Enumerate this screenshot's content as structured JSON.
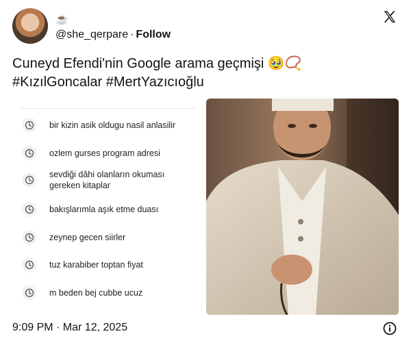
{
  "author": {
    "emoji": "☕",
    "handle": "@she_qerpare",
    "separator": "·",
    "follow_label": "Follow"
  },
  "tweet": {
    "line1": "Cuneyd Efendi'nin Google arama geçmişi 🥹📿",
    "line2": "#KızılGoncalar #MertYazıcıoğlu"
  },
  "search_history": [
    "bir kizin asik oldugu nasil anlasilir",
    "ozlem gurses program adresi",
    "sevdiği dâhi olanların okuması gereken kitaplar",
    "bakışlarımla aşık etme duası",
    "zeynep gecen siirler",
    "tuz karabiber toptan fiyat",
    "m beden bej cubbe ucuz"
  ],
  "footer": {
    "timestamp": "9:09 PM · Mar 12, 2025"
  },
  "icons": {
    "x_logo": "x-logo-icon",
    "history": "clock-icon",
    "info": "info-icon"
  },
  "colors": {
    "text": "#0f1419",
    "clock_bg": "#f1f3f4",
    "clock_stroke": "#5f6368"
  }
}
